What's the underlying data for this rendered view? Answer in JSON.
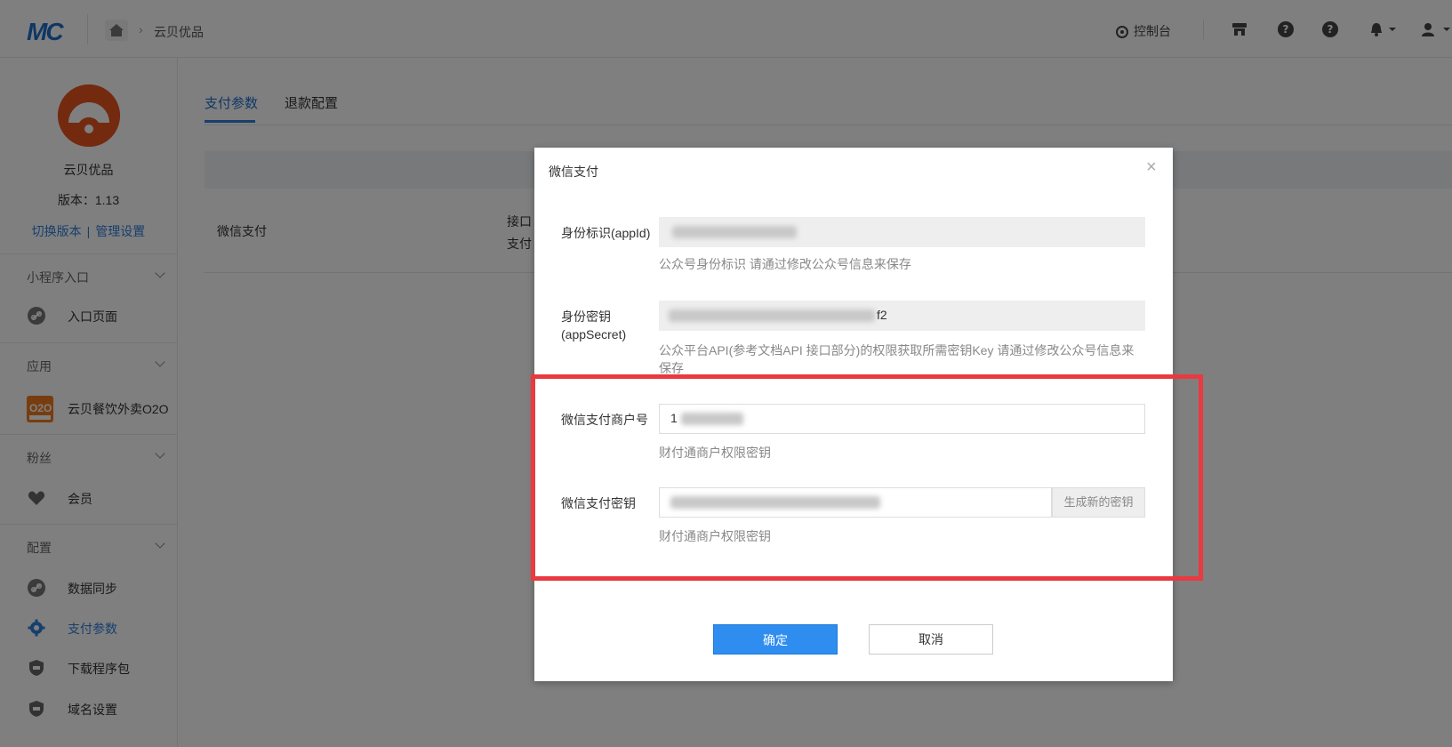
{
  "header": {
    "logo": "MC",
    "breadcrumb_current": "云贝优品",
    "console_label": "控制台"
  },
  "sidebar": {
    "app_name": "云贝优品",
    "version": "版本：1.13",
    "switch_version": "切换版本",
    "link_separator": "|",
    "manage_settings": "管理设置",
    "sections": [
      {
        "title": "小程序入口",
        "items": [
          {
            "label": "入口页面"
          }
        ]
      },
      {
        "title": "应用",
        "items": [
          {
            "label": "云贝餐饮外卖O2O"
          }
        ]
      },
      {
        "title": "粉丝",
        "items": [
          {
            "label": "会员"
          }
        ]
      },
      {
        "title": "配置",
        "items": [
          {
            "label": "数据同步"
          },
          {
            "label": "支付参数"
          },
          {
            "label": "下载程序包"
          },
          {
            "label": "域名设置"
          }
        ]
      }
    ]
  },
  "main": {
    "tabs": [
      {
        "label": "支付参数"
      },
      {
        "label": "退款配置"
      }
    ],
    "row_label": "微信支付",
    "row_mid_1": "接口",
    "row_mid_2": "支付"
  },
  "modal": {
    "title": "微信支付",
    "close": "×",
    "fields": [
      {
        "label": "身份标识(appId)",
        "value": "",
        "help": "公众号身份标识 请通过修改公众号信息来保存"
      },
      {
        "label": "身份密钥(appSecret)",
        "value": "f2",
        "help": "公众平台API(参考文档API 接口部分)的权限获取所需密钥Key 请通过修改公众号信息来保存"
      },
      {
        "label": "微信支付商户号",
        "value": "1",
        "help": "财付通商户权限密钥"
      },
      {
        "label": "微信支付密钥",
        "value": "",
        "help": "财付通商户权限密钥",
        "button": "生成新的密钥"
      }
    ],
    "ok": "确定",
    "cancel": "取消"
  },
  "colors": {
    "accent": "#2f8df0",
    "link": "#2f7fd8",
    "highlight": "#e93a3f",
    "avatar": "#e6541f"
  }
}
